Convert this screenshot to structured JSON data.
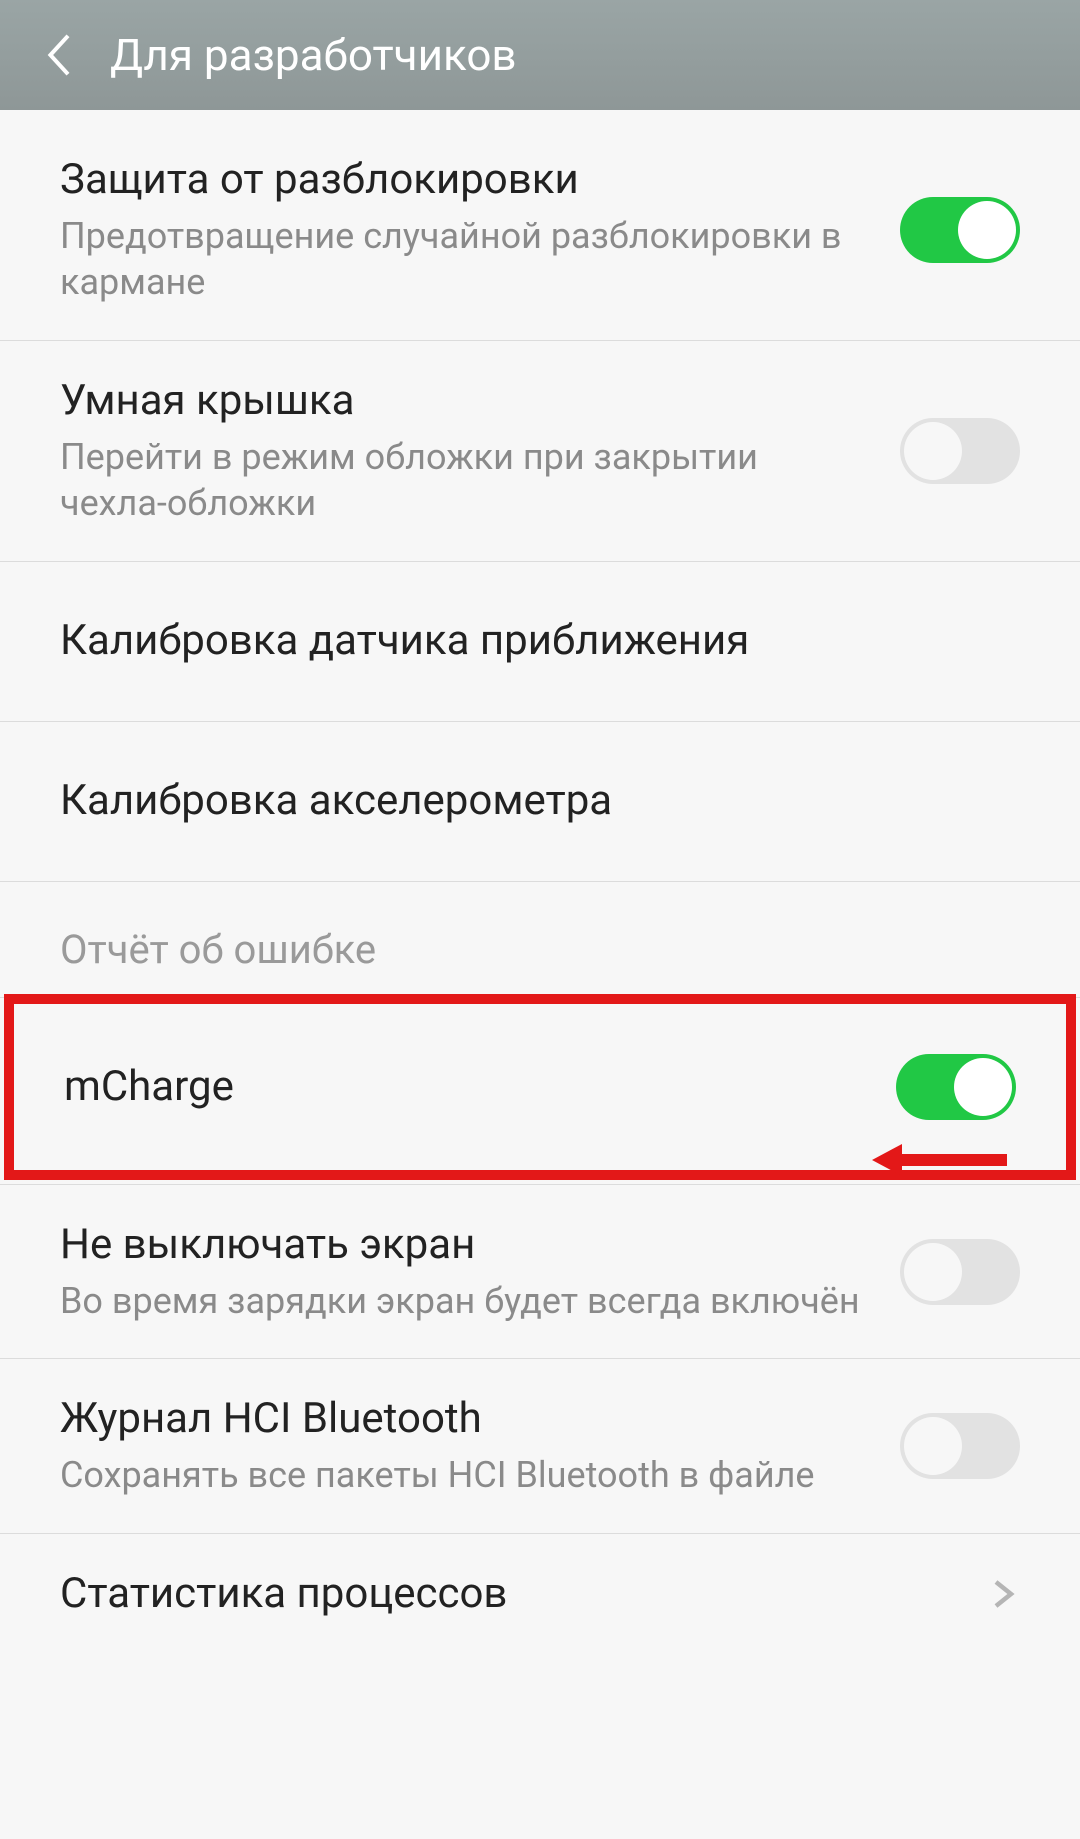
{
  "header": {
    "title": "Для разработчиков"
  },
  "rows": {
    "unlock_protect": {
      "title": "Защита от разблокировки",
      "subtitle": "Предотвращение случайной разблокировки в кармане",
      "toggle": "on"
    },
    "smart_cover": {
      "title": "Умная крышка",
      "subtitle": "Перейти в режим обложки при закрытии чехла-обложки",
      "toggle": "off"
    },
    "prox_cal": {
      "title": "Калибровка датчика приближения"
    },
    "accel_cal": {
      "title": "Калибровка акселерометра"
    },
    "section_bugreport": "Отчёт об ошибке",
    "mcharge": {
      "title": "mCharge",
      "toggle": "on"
    },
    "stay_awake": {
      "title": "Не выключать экран",
      "subtitle": "Во время зарядки экран будет всегда включён",
      "toggle": "off"
    },
    "hci_log": {
      "title": "Журнал HCI Bluetooth",
      "subtitle": "Сохранять все пакеты HCI Bluetooth в файле",
      "toggle": "off"
    },
    "proc_stats": {
      "title": "Статистика процессов"
    }
  },
  "annotation": {
    "highlight_target": "mcharge",
    "arrow_direction": "left",
    "color": "#e31818"
  }
}
